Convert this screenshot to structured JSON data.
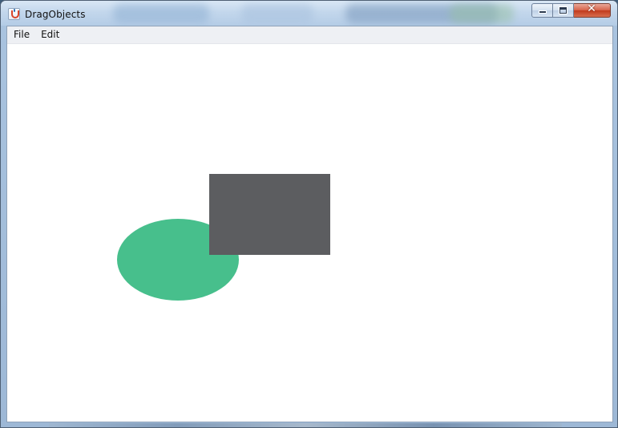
{
  "window": {
    "title": "DragObjects",
    "app_icon": "java-cup-icon",
    "controls": {
      "minimize_icon": "minimize-icon",
      "maximize_icon": "maximize-icon",
      "close_icon": "close-icon",
      "close_glyph": "✕"
    }
  },
  "menubar": {
    "items": [
      {
        "label": "File"
      },
      {
        "label": "Edit"
      }
    ]
  },
  "canvas": {
    "shapes": [
      {
        "kind": "ellipse",
        "color": "#47bf8c"
      },
      {
        "kind": "rectangle",
        "color": "#5c5d60"
      }
    ]
  },
  "colors": {
    "canvas_background": "#ffffff",
    "menubar_background": "#eef0f4",
    "titlebar_top": "#d9e7f5",
    "titlebar_bottom": "#b4cce6",
    "close_button": "#c13b1d"
  }
}
